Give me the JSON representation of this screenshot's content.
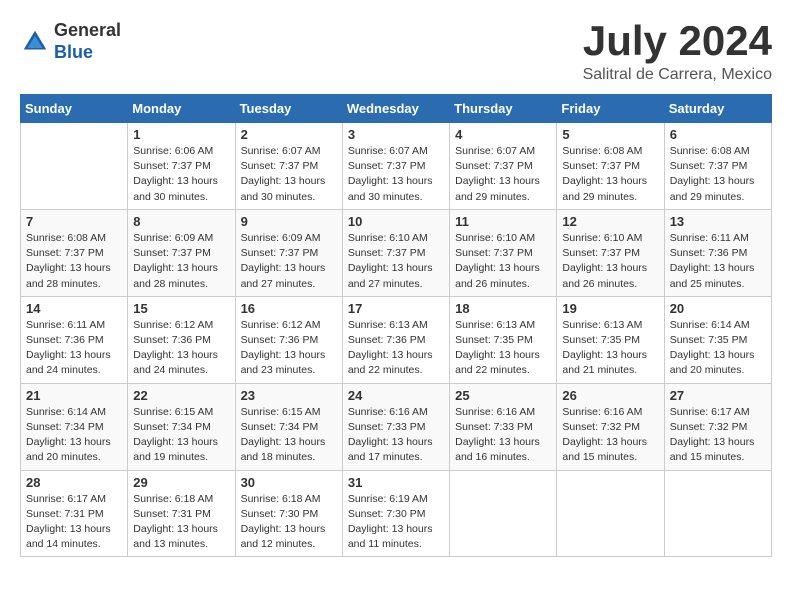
{
  "header": {
    "logo_line1": "General",
    "logo_line2": "Blue",
    "month_title": "July 2024",
    "location": "Salitral de Carrera, Mexico"
  },
  "weekdays": [
    "Sunday",
    "Monday",
    "Tuesday",
    "Wednesday",
    "Thursday",
    "Friday",
    "Saturday"
  ],
  "weeks": [
    [
      {
        "day": "",
        "info": ""
      },
      {
        "day": "1",
        "info": "Sunrise: 6:06 AM\nSunset: 7:37 PM\nDaylight: 13 hours\nand 30 minutes."
      },
      {
        "day": "2",
        "info": "Sunrise: 6:07 AM\nSunset: 7:37 PM\nDaylight: 13 hours\nand 30 minutes."
      },
      {
        "day": "3",
        "info": "Sunrise: 6:07 AM\nSunset: 7:37 PM\nDaylight: 13 hours\nand 30 minutes."
      },
      {
        "day": "4",
        "info": "Sunrise: 6:07 AM\nSunset: 7:37 PM\nDaylight: 13 hours\nand 29 minutes."
      },
      {
        "day": "5",
        "info": "Sunrise: 6:08 AM\nSunset: 7:37 PM\nDaylight: 13 hours\nand 29 minutes."
      },
      {
        "day": "6",
        "info": "Sunrise: 6:08 AM\nSunset: 7:37 PM\nDaylight: 13 hours\nand 29 minutes."
      }
    ],
    [
      {
        "day": "7",
        "info": "Sunrise: 6:08 AM\nSunset: 7:37 PM\nDaylight: 13 hours\nand 28 minutes."
      },
      {
        "day": "8",
        "info": "Sunrise: 6:09 AM\nSunset: 7:37 PM\nDaylight: 13 hours\nand 28 minutes."
      },
      {
        "day": "9",
        "info": "Sunrise: 6:09 AM\nSunset: 7:37 PM\nDaylight: 13 hours\nand 27 minutes."
      },
      {
        "day": "10",
        "info": "Sunrise: 6:10 AM\nSunset: 7:37 PM\nDaylight: 13 hours\nand 27 minutes."
      },
      {
        "day": "11",
        "info": "Sunrise: 6:10 AM\nSunset: 7:37 PM\nDaylight: 13 hours\nand 26 minutes."
      },
      {
        "day": "12",
        "info": "Sunrise: 6:10 AM\nSunset: 7:37 PM\nDaylight: 13 hours\nand 26 minutes."
      },
      {
        "day": "13",
        "info": "Sunrise: 6:11 AM\nSunset: 7:36 PM\nDaylight: 13 hours\nand 25 minutes."
      }
    ],
    [
      {
        "day": "14",
        "info": "Sunrise: 6:11 AM\nSunset: 7:36 PM\nDaylight: 13 hours\nand 24 minutes."
      },
      {
        "day": "15",
        "info": "Sunrise: 6:12 AM\nSunset: 7:36 PM\nDaylight: 13 hours\nand 24 minutes."
      },
      {
        "day": "16",
        "info": "Sunrise: 6:12 AM\nSunset: 7:36 PM\nDaylight: 13 hours\nand 23 minutes."
      },
      {
        "day": "17",
        "info": "Sunrise: 6:13 AM\nSunset: 7:36 PM\nDaylight: 13 hours\nand 22 minutes."
      },
      {
        "day": "18",
        "info": "Sunrise: 6:13 AM\nSunset: 7:35 PM\nDaylight: 13 hours\nand 22 minutes."
      },
      {
        "day": "19",
        "info": "Sunrise: 6:13 AM\nSunset: 7:35 PM\nDaylight: 13 hours\nand 21 minutes."
      },
      {
        "day": "20",
        "info": "Sunrise: 6:14 AM\nSunset: 7:35 PM\nDaylight: 13 hours\nand 20 minutes."
      }
    ],
    [
      {
        "day": "21",
        "info": "Sunrise: 6:14 AM\nSunset: 7:34 PM\nDaylight: 13 hours\nand 20 minutes."
      },
      {
        "day": "22",
        "info": "Sunrise: 6:15 AM\nSunset: 7:34 PM\nDaylight: 13 hours\nand 19 minutes."
      },
      {
        "day": "23",
        "info": "Sunrise: 6:15 AM\nSunset: 7:34 PM\nDaylight: 13 hours\nand 18 minutes."
      },
      {
        "day": "24",
        "info": "Sunrise: 6:16 AM\nSunset: 7:33 PM\nDaylight: 13 hours\nand 17 minutes."
      },
      {
        "day": "25",
        "info": "Sunrise: 6:16 AM\nSunset: 7:33 PM\nDaylight: 13 hours\nand 16 minutes."
      },
      {
        "day": "26",
        "info": "Sunrise: 6:16 AM\nSunset: 7:32 PM\nDaylight: 13 hours\nand 15 minutes."
      },
      {
        "day": "27",
        "info": "Sunrise: 6:17 AM\nSunset: 7:32 PM\nDaylight: 13 hours\nand 15 minutes."
      }
    ],
    [
      {
        "day": "28",
        "info": "Sunrise: 6:17 AM\nSunset: 7:31 PM\nDaylight: 13 hours\nand 14 minutes."
      },
      {
        "day": "29",
        "info": "Sunrise: 6:18 AM\nSunset: 7:31 PM\nDaylight: 13 hours\nand 13 minutes."
      },
      {
        "day": "30",
        "info": "Sunrise: 6:18 AM\nSunset: 7:30 PM\nDaylight: 13 hours\nand 12 minutes."
      },
      {
        "day": "31",
        "info": "Sunrise: 6:19 AM\nSunset: 7:30 PM\nDaylight: 13 hours\nand 11 minutes."
      },
      {
        "day": "",
        "info": ""
      },
      {
        "day": "",
        "info": ""
      },
      {
        "day": "",
        "info": ""
      }
    ]
  ]
}
